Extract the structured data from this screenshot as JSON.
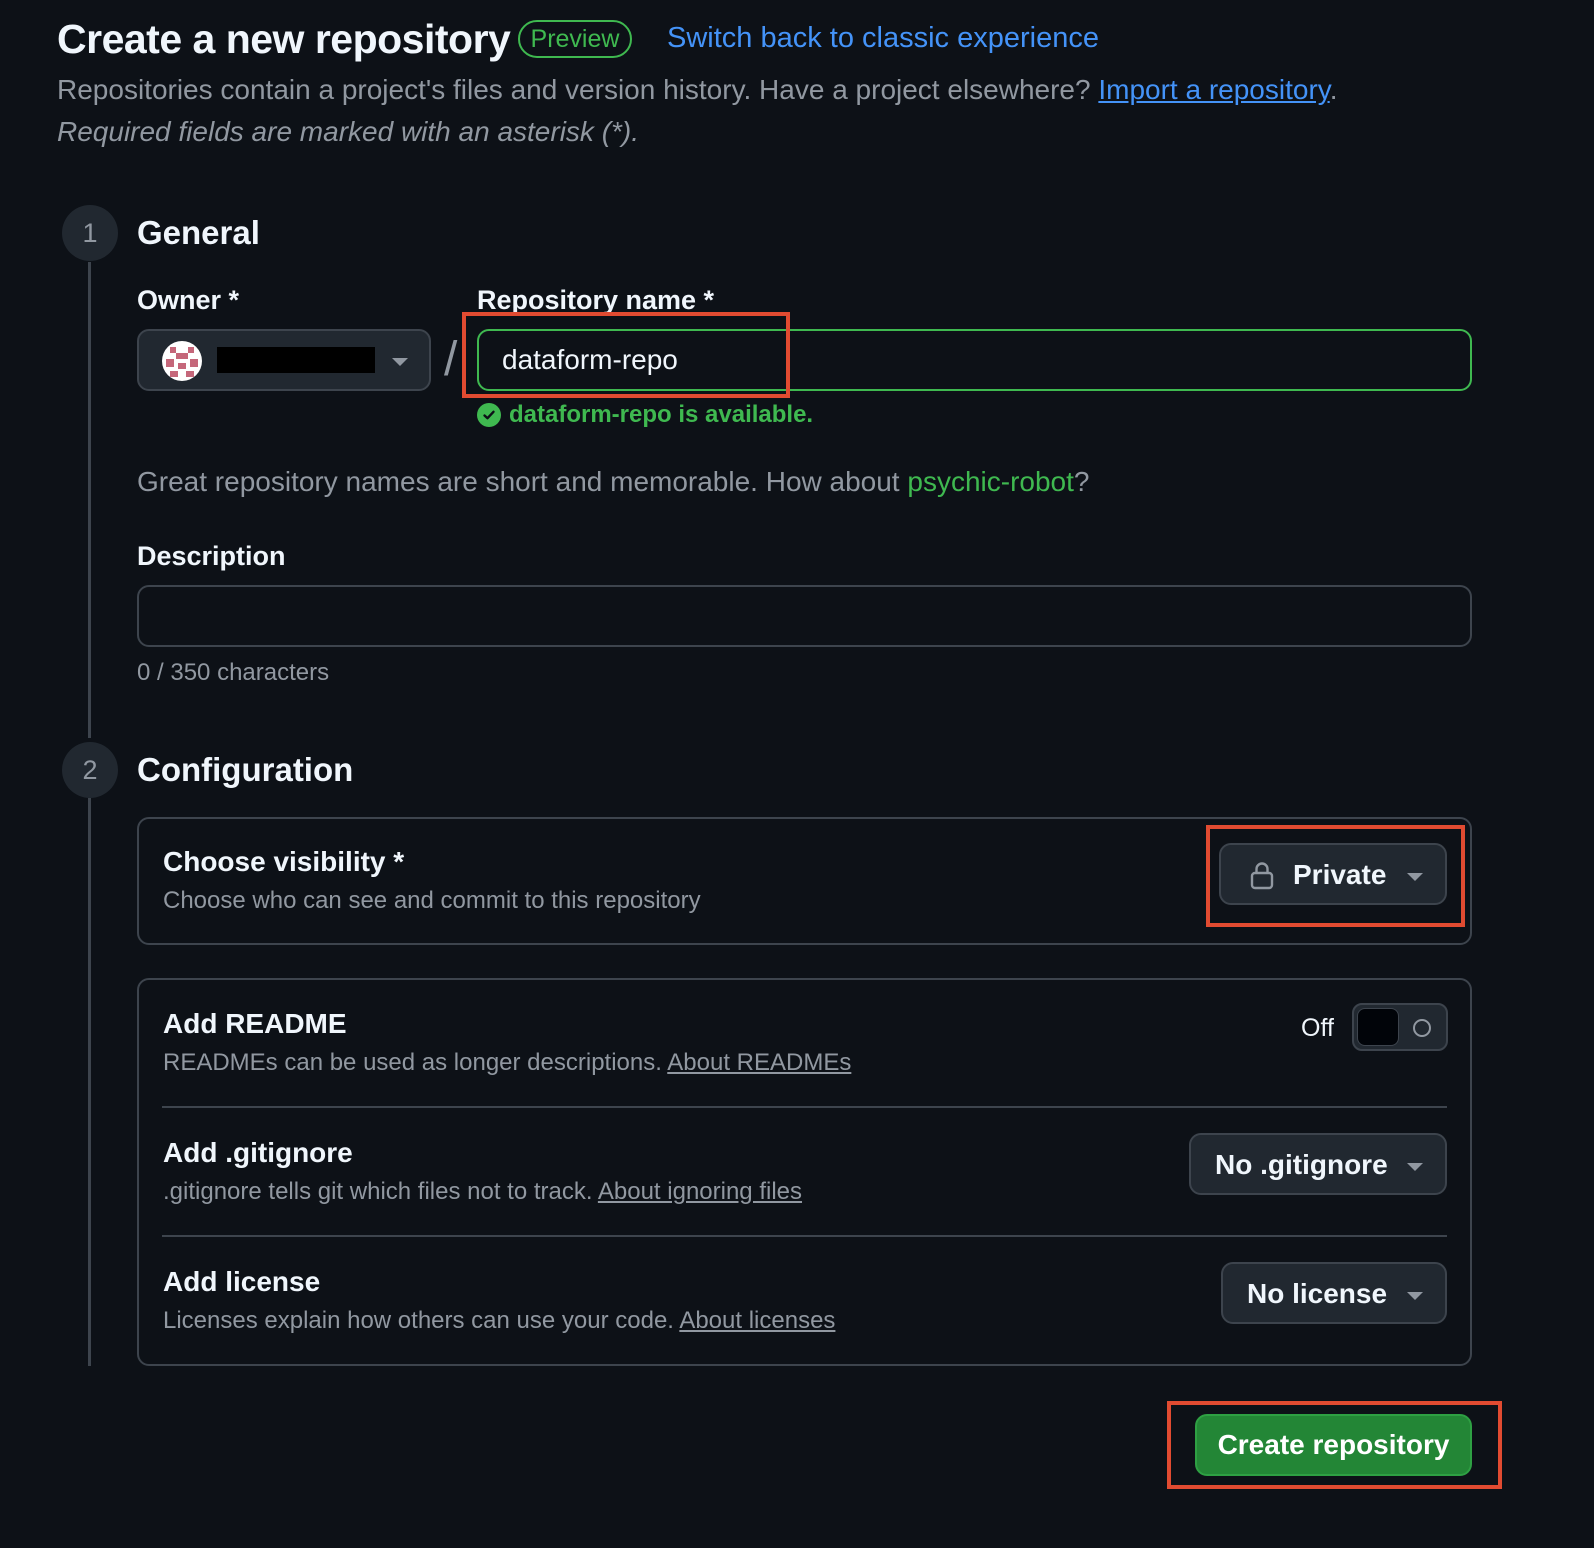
{
  "header": {
    "title": "Create a new repository",
    "badge": "Preview",
    "switch_link": "Switch back to classic experience",
    "intro_text": "Repositories contain a project's files and version history. Have a project elsewhere?",
    "import_link": "Import a repository",
    "required_note": "Required fields are marked with an asterisk (*)."
  },
  "general": {
    "step": "1",
    "heading": "General",
    "owner_label": "Owner *",
    "repo_label": "Repository name *",
    "separator": "/",
    "repo_value": "dataform-repo",
    "availability": "dataform-repo is available.",
    "suggestion_prefix": "Great repository names are short and memorable. How about",
    "suggestion_name": "psychic-robot",
    "suggestion_suffix": "?",
    "description_label": "Description",
    "description_value": "",
    "char_count": "0 / 350 characters"
  },
  "configuration": {
    "step": "2",
    "heading": "Configuration",
    "visibility": {
      "title": "Choose visibility *",
      "desc": "Choose who can see and commit to this repository",
      "value": "Private",
      "icon": "lock-icon"
    },
    "readme": {
      "title": "Add README",
      "desc": "READMEs can be used as longer descriptions.",
      "link": "About READMEs",
      "toggle_label": "Off"
    },
    "gitignore": {
      "title": "Add .gitignore",
      "desc": ".gitignore tells git which files not to track.",
      "link": "About ignoring files",
      "value": "No .gitignore"
    },
    "license": {
      "title": "Add license",
      "desc": "Licenses explain how others can use your code.",
      "link": "About licenses",
      "value": "No license"
    }
  },
  "actions": {
    "create_label": "Create repository"
  },
  "colors": {
    "background": "#0d1117",
    "accent_green": "#3fb950",
    "link_blue": "#4493f8",
    "annotation_red": "#e14b31"
  }
}
